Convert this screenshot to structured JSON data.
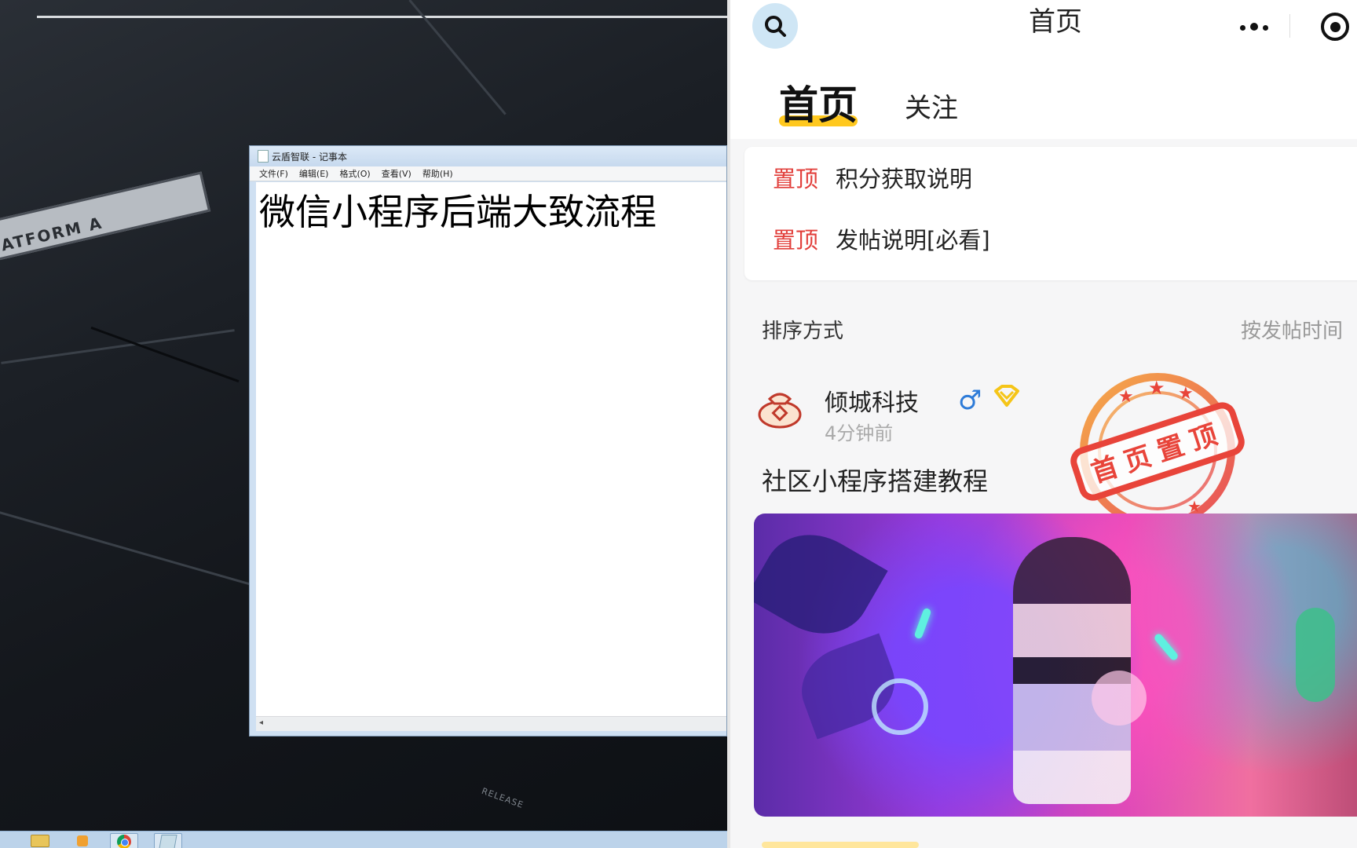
{
  "desktop": {
    "platform_label": "ATFORM A",
    "release_label": "RELEASE"
  },
  "notepad": {
    "title": "云盾智联 - 记事本",
    "menu": [
      "文件(F)",
      "编辑(E)",
      "格式(O)",
      "查看(V)",
      "帮助(H)"
    ],
    "content": "微信小程序后端大致流程"
  },
  "taskbar": {
    "icons": [
      "folder-icon",
      "media-player-icon",
      "chrome-icon",
      "notepad-icon"
    ]
  },
  "phone": {
    "nav_title": "首页",
    "tabs": [
      {
        "label": "首页",
        "active": true
      },
      {
        "label": "关注",
        "active": false
      }
    ],
    "pinned": [
      {
        "tag": "置顶",
        "title": "积分获取说明"
      },
      {
        "tag": "置顶",
        "title": "发帖说明[必看]"
      }
    ],
    "sort": {
      "label": "排序方式",
      "value": "按发帖时间"
    },
    "post": {
      "author": "倾城科技",
      "time": "4分钟前",
      "title": "社区小程序搭建教程",
      "stamp_text": "首页置顶"
    },
    "colors": {
      "accent": "#ffc81e",
      "pin_tag": "#e2403c",
      "stamp": "#e8443a",
      "male": "#2d7bd8",
      "vip": "#f5c518"
    }
  }
}
